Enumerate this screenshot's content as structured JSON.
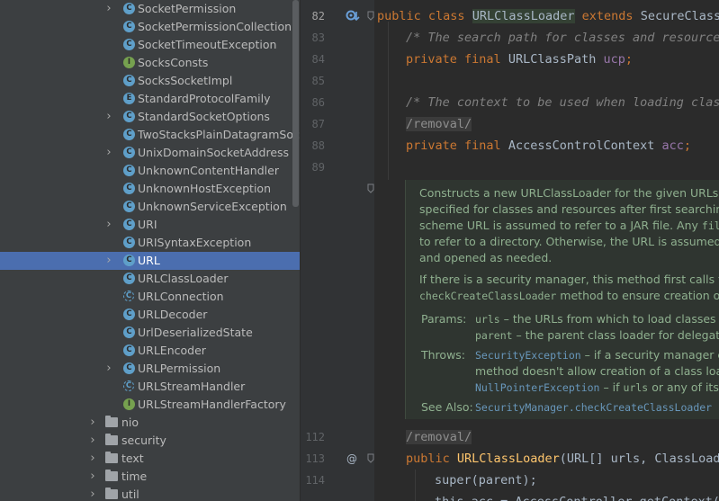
{
  "tree": {
    "items": [
      {
        "label": "SocketPermission",
        "icon": "class-icon",
        "glyph": "C",
        "expand": true
      },
      {
        "label": "SocketPermissionCollection",
        "icon": "class-icon",
        "glyph": "C",
        "expand": false
      },
      {
        "label": "SocketTimeoutException",
        "icon": "class-icon",
        "glyph": "C",
        "expand": false
      },
      {
        "label": "SocksConsts",
        "icon": "interface-icon",
        "glyph": "I",
        "expand": false
      },
      {
        "label": "SocksSocketImpl",
        "icon": "class-icon",
        "glyph": "C",
        "expand": false
      },
      {
        "label": "StandardProtocolFamily",
        "icon": "enum-icon",
        "glyph": "E",
        "expand": false
      },
      {
        "label": "StandardSocketOptions",
        "icon": "class-icon",
        "glyph": "C",
        "expand": true
      },
      {
        "label": "TwoStacksPlainDatagramSocke",
        "icon": "class-icon",
        "glyph": "C",
        "expand": false
      },
      {
        "label": "UnixDomainSocketAddress",
        "icon": "class-icon",
        "glyph": "C",
        "expand": true
      },
      {
        "label": "UnknownContentHandler",
        "icon": "class-icon",
        "glyph": "C",
        "expand": false
      },
      {
        "label": "UnknownHostException",
        "icon": "class-icon",
        "glyph": "C",
        "expand": false
      },
      {
        "label": "UnknownServiceException",
        "icon": "class-icon",
        "glyph": "C",
        "expand": false
      },
      {
        "label": "URI",
        "icon": "class-icon",
        "glyph": "C",
        "expand": true
      },
      {
        "label": "URISyntaxException",
        "icon": "class-icon",
        "glyph": "C",
        "expand": false
      },
      {
        "label": "URL",
        "icon": "class-icon",
        "glyph": "C",
        "expand": true,
        "selected": true
      },
      {
        "label": "URLClassLoader",
        "icon": "class-icon",
        "glyph": "C",
        "expand": false
      },
      {
        "label": "URLConnection",
        "icon": "abstract-class-icon",
        "glyph": "C",
        "expand": false
      },
      {
        "label": "URLDecoder",
        "icon": "class-icon",
        "glyph": "C",
        "expand": false
      },
      {
        "label": "UrlDeserializedState",
        "icon": "class-icon",
        "glyph": "C",
        "expand": false
      },
      {
        "label": "URLEncoder",
        "icon": "class-icon",
        "glyph": "C",
        "expand": false
      },
      {
        "label": "URLPermission",
        "icon": "class-icon",
        "glyph": "C",
        "expand": true
      },
      {
        "label": "URLStreamHandler",
        "icon": "abstract-class-icon",
        "glyph": "C",
        "expand": false
      },
      {
        "label": "URLStreamHandlerFactory",
        "icon": "interface-icon",
        "glyph": "I",
        "expand": false
      }
    ],
    "folders": [
      "nio",
      "security",
      "text",
      "time",
      "util"
    ]
  },
  "editor": {
    "line_numbers": [
      "82",
      "83",
      "84",
      "85",
      "86",
      "87",
      "88",
      "89",
      "112",
      "113",
      "114"
    ],
    "lines": {
      "l82_kw1": "public",
      "l82_kw2": "class",
      "l82_name": "URLClassLoader",
      "l82_kw3": "extends",
      "l82_super": "SecureClassL",
      "l83": "/* The search path for classes and resources",
      "l84_kw": "private final",
      "l84_type": "URLClassPath",
      "l84_field": "ucp",
      "l86": "/* The context to be used when loading class",
      "l87": "/removal/",
      "l88_kw": "private final",
      "l88_type": "AccessControlContext",
      "l88_field": "acc",
      "l112": "/removal/",
      "l113_kw": "public",
      "l113_name": "URLClassLoader",
      "l113_rest": "(URL[] urls, ClassLoad",
      "l114": "super(parent);",
      "l115": "this.acc = AccessController.getContext();"
    },
    "doc": {
      "p1": [
        "Constructs a new URLClassLoader for the given URLs.",
        "specified for classes and resources after first searching",
        "scheme URL is assumed to refer to a JAR file. Any",
        "to refer to a directory. Otherwise, the URL is assumed",
        "and opened as needed."
      ],
      "p1_code": "file",
      "p2": "If there is a security manager, this method first calls th",
      "p2_code": "checkCreateClassLoader",
      "p2_rest": " method to ensure creation o",
      "params_label": "Params:",
      "param1_name": "urls",
      "param1_text": " – the URLs from which to load classes",
      "param2_name": "parent",
      "param2_text": " – the parent class loader for delegat",
      "throws_label": "Throws:",
      "throws1_name": "SecurityException",
      "throws1_text": " – if a security manager e",
      "throws1_cont": "method doesn't allow creation of a class load",
      "throws2_name": "NullPointerException",
      "throws2_text": " – if ",
      "throws2_code": "urls",
      "throws2_rest": " or any of its",
      "see_label": "See Also:",
      "see_link": "SecurityManager.checkCreateClassLoader"
    }
  }
}
